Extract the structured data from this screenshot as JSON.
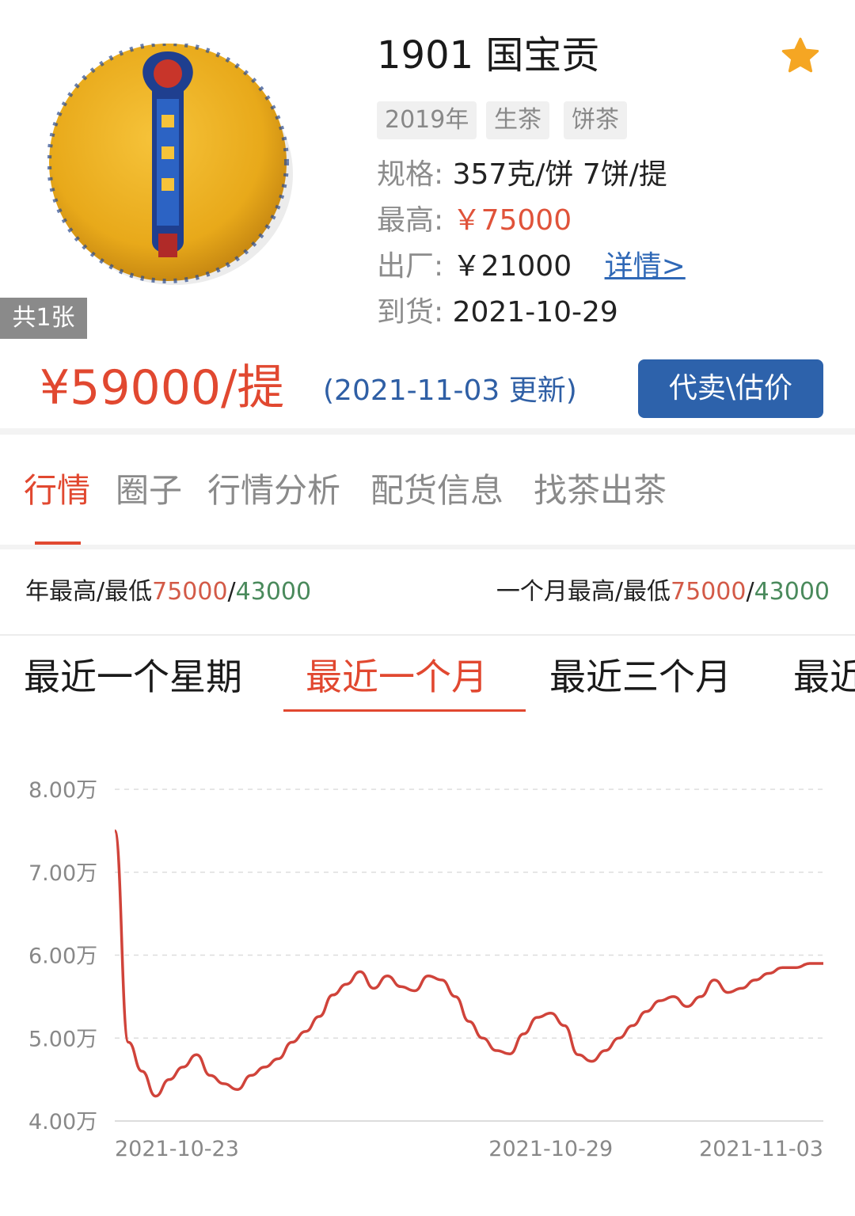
{
  "product": {
    "title": "1901 国宝贡",
    "photo_count": "共1张",
    "tags": [
      "2019年",
      "生茶",
      "饼茶"
    ],
    "spec_label": "规格:",
    "spec_value": "357克/饼 7饼/提",
    "highest_label": "最高:",
    "highest_value": "￥75000",
    "factory_label": "出厂:",
    "factory_value": "￥21000",
    "detail_link": "详情>",
    "arrival_label": "到货:",
    "arrival_value": "2021-10-29",
    "current_price": "¥59000/提",
    "update_time": "(2021-11-03 更新)",
    "consign_button": "代卖\\估价"
  },
  "main_tabs": [
    {
      "label": "行情",
      "active": true
    },
    {
      "label": "圈子",
      "active": false
    },
    {
      "label": "行情分析",
      "active": false
    },
    {
      "label": "配货信息",
      "active": false
    },
    {
      "label": "找茶出茶",
      "active": false
    }
  ],
  "ranges": {
    "year_label": "年最高/最低",
    "year_high": "75000",
    "year_low": "43000",
    "month_label": "一个月最高/最低",
    "month_high": "75000",
    "month_low": "43000",
    "sep": "/"
  },
  "period_tabs": [
    {
      "label": "最近一个星期",
      "active": false
    },
    {
      "label": "最近一个月",
      "active": true
    },
    {
      "label": "最近三个月",
      "active": false
    },
    {
      "label": "最近",
      "active": false
    }
  ],
  "colors": {
    "accent_red": "#e14830",
    "button_blue": "#2d62ab",
    "link_blue": "#2f68b6",
    "low_green": "#4a8a5c",
    "star_orange": "#f5a623"
  },
  "chart_data": {
    "type": "line",
    "y_tick_labels": [
      "8.00万",
      "7.00万",
      "6.00万",
      "5.00万",
      "4.00万"
    ],
    "y_ticks": [
      80000,
      70000,
      60000,
      50000,
      40000
    ],
    "ylim": [
      40000,
      80000
    ],
    "x_tick_labels": [
      "2021-10-23",
      "2021-10-29",
      "2021-11-03"
    ],
    "x_tick_positions": [
      2,
      8,
      13
    ],
    "xlim": [
      0,
      13
    ],
    "grid": true,
    "series": [
      {
        "color": "#d0433a",
        "x": [
          0,
          0.25,
          0.5,
          0.75,
          1.0,
          1.25,
          1.5,
          1.75,
          2.0,
          2.25,
          2.5,
          2.75,
          3.0,
          3.25,
          3.5,
          3.75,
          4.0,
          4.25,
          4.5,
          4.75,
          5.0,
          5.25,
          5.5,
          5.75,
          6.0,
          6.25,
          6.5,
          6.75,
          7.0,
          7.25,
          7.5,
          7.75,
          8.0,
          8.25,
          8.5,
          8.75,
          9.0,
          9.25,
          9.5,
          9.75,
          10.0,
          10.25,
          10.5,
          10.75,
          11.0,
          11.25,
          11.5,
          11.75,
          12.0,
          12.25,
          12.5,
          12.75,
          13.0
        ],
        "values": [
          75000,
          49500,
          46000,
          43000,
          45000,
          46500,
          48000,
          45500,
          44500,
          43800,
          45500,
          46500,
          47500,
          49500,
          50800,
          52600,
          55200,
          56500,
          58000,
          56000,
          57500,
          56200,
          55700,
          57500,
          57000,
          55000,
          52000,
          50000,
          48500,
          48100,
          50500,
          52500,
          53000,
          51500,
          48000,
          47200,
          48500,
          50000,
          51500,
          53200,
          54500,
          55000,
          53800,
          55000,
          57000,
          55500,
          56000,
          57000,
          57800,
          58500,
          58500,
          59000,
          59000
        ]
      }
    ]
  }
}
